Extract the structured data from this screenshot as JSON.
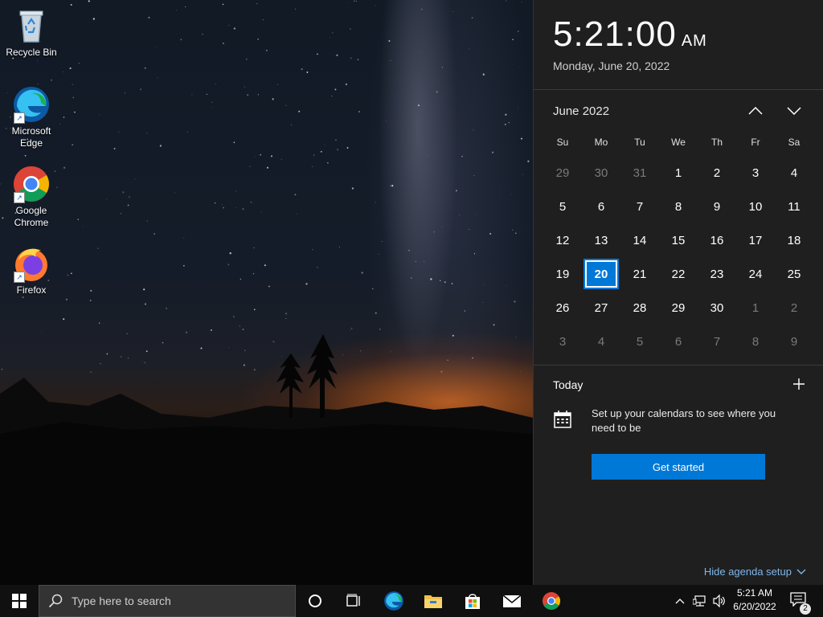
{
  "desktop": {
    "icons": [
      {
        "label": "Recycle Bin"
      },
      {
        "label": "Microsoft Edge"
      },
      {
        "label": "Google Chrome"
      },
      {
        "label": "Firefox"
      }
    ]
  },
  "flyout": {
    "time": "5:21:00",
    "ampm": "AM",
    "date": "Monday, June 20, 2022",
    "month_title": "June 2022",
    "weekdays": [
      "Su",
      "Mo",
      "Tu",
      "We",
      "Th",
      "Fr",
      "Sa"
    ],
    "days": [
      {
        "d": "29",
        "other": true
      },
      {
        "d": "30",
        "other": true
      },
      {
        "d": "31",
        "other": true
      },
      {
        "d": "1"
      },
      {
        "d": "2"
      },
      {
        "d": "3"
      },
      {
        "d": "4"
      },
      {
        "d": "5"
      },
      {
        "d": "6"
      },
      {
        "d": "7"
      },
      {
        "d": "8"
      },
      {
        "d": "9"
      },
      {
        "d": "10"
      },
      {
        "d": "11"
      },
      {
        "d": "12"
      },
      {
        "d": "13"
      },
      {
        "d": "14"
      },
      {
        "d": "15"
      },
      {
        "d": "16"
      },
      {
        "d": "17"
      },
      {
        "d": "18"
      },
      {
        "d": "19"
      },
      {
        "d": "20",
        "today": true
      },
      {
        "d": "21"
      },
      {
        "d": "22"
      },
      {
        "d": "23"
      },
      {
        "d": "24"
      },
      {
        "d": "25"
      },
      {
        "d": "26"
      },
      {
        "d": "27"
      },
      {
        "d": "28"
      },
      {
        "d": "29"
      },
      {
        "d": "30"
      },
      {
        "d": "1",
        "other": true
      },
      {
        "d": "2",
        "other": true
      },
      {
        "d": "3",
        "other": true
      },
      {
        "d": "4",
        "other": true
      },
      {
        "d": "5",
        "other": true
      },
      {
        "d": "6",
        "other": true
      },
      {
        "d": "7",
        "other": true
      },
      {
        "d": "8",
        "other": true
      },
      {
        "d": "9",
        "other": true
      }
    ],
    "today_label": "Today",
    "setup_text": "Set up your calendars to see where you need to be",
    "get_started_label": "Get started",
    "hide_agenda_label": "Hide agenda setup"
  },
  "taskbar": {
    "search_placeholder": "Type here to search",
    "clock_time": "5:21 AM",
    "clock_date": "6/20/2022",
    "notification_count": "2",
    "pinned": [
      "cortana-icon",
      "task-view-icon",
      "edge-icon",
      "file-explorer-icon",
      "store-icon",
      "mail-icon",
      "chrome-icon"
    ]
  },
  "colors": {
    "accent": "#0078d7",
    "flyout_bg": "#1f1f1f",
    "taskbar_bg": "#101010"
  }
}
